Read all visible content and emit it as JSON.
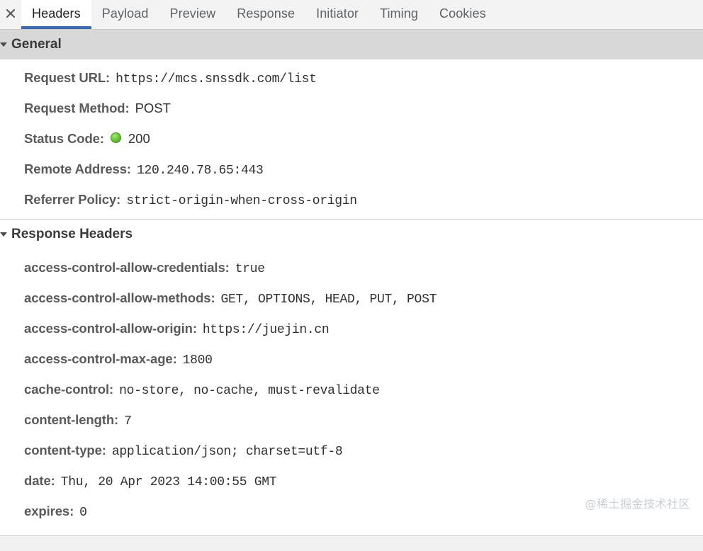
{
  "tabbar": {
    "close_label": "×",
    "close_icon": "close-icon",
    "tabs": [
      {
        "label": "Headers",
        "active": true
      },
      {
        "label": "Payload",
        "active": false
      },
      {
        "label": "Preview",
        "active": false
      },
      {
        "label": "Response",
        "active": false
      },
      {
        "label": "Initiator",
        "active": false
      },
      {
        "label": "Timing",
        "active": false
      },
      {
        "label": "Cookies",
        "active": false
      }
    ],
    "active_underline_color": "#3c6ab0"
  },
  "sections": {
    "general": {
      "title": "General",
      "expanded": true,
      "triangle": "triangle-down-icon",
      "background_color": "#d8d8d8",
      "rows": [
        {
          "key": "Request URL:",
          "value": "https://mcs.snssdk.com/list",
          "mono": true,
          "dot": false
        },
        {
          "key": "Request Method:",
          "value": "POST",
          "mono": false,
          "dot": false
        },
        {
          "key": "Status Code:",
          "value": "200",
          "mono": false,
          "dot": true
        },
        {
          "key": "Remote Address:",
          "value": "120.240.78.65:443",
          "mono": true,
          "dot": false
        },
        {
          "key": "Referrer Policy:",
          "value": "strict-origin-when-cross-origin",
          "mono": true,
          "dot": false
        }
      ]
    },
    "response_headers": {
      "title": "Response Headers",
      "expanded": true,
      "triangle": "triangle-down-icon",
      "background_color": "#ffffff",
      "rows": [
        {
          "key": "access-control-allow-credentials:",
          "value": "true",
          "mono": true,
          "dot": false
        },
        {
          "key": "access-control-allow-methods:",
          "value": "GET, OPTIONS, HEAD, PUT, POST",
          "mono": true,
          "dot": false
        },
        {
          "key": "access-control-allow-origin:",
          "value": "https://juejin.cn",
          "mono": true,
          "dot": false
        },
        {
          "key": "access-control-max-age:",
          "value": "1800",
          "mono": true,
          "dot": false
        },
        {
          "key": "cache-control:",
          "value": "no-store, no-cache, must-revalidate",
          "mono": true,
          "dot": false
        },
        {
          "key": "content-length:",
          "value": "7",
          "mono": true,
          "dot": false
        },
        {
          "key": "content-type:",
          "value": "application/json; charset=utf-8",
          "mono": true,
          "dot": false
        },
        {
          "key": "date:",
          "value": "Thu, 20 Apr 2023 14:00:55 GMT",
          "mono": true,
          "dot": false
        },
        {
          "key": "expires:",
          "value": "0",
          "mono": true,
          "dot": false
        }
      ]
    }
  },
  "watermark": {
    "text": "@稀土掘金技术社区"
  },
  "status_indicator": {
    "name": "status-ok-dot",
    "color": "#6fc83a"
  }
}
